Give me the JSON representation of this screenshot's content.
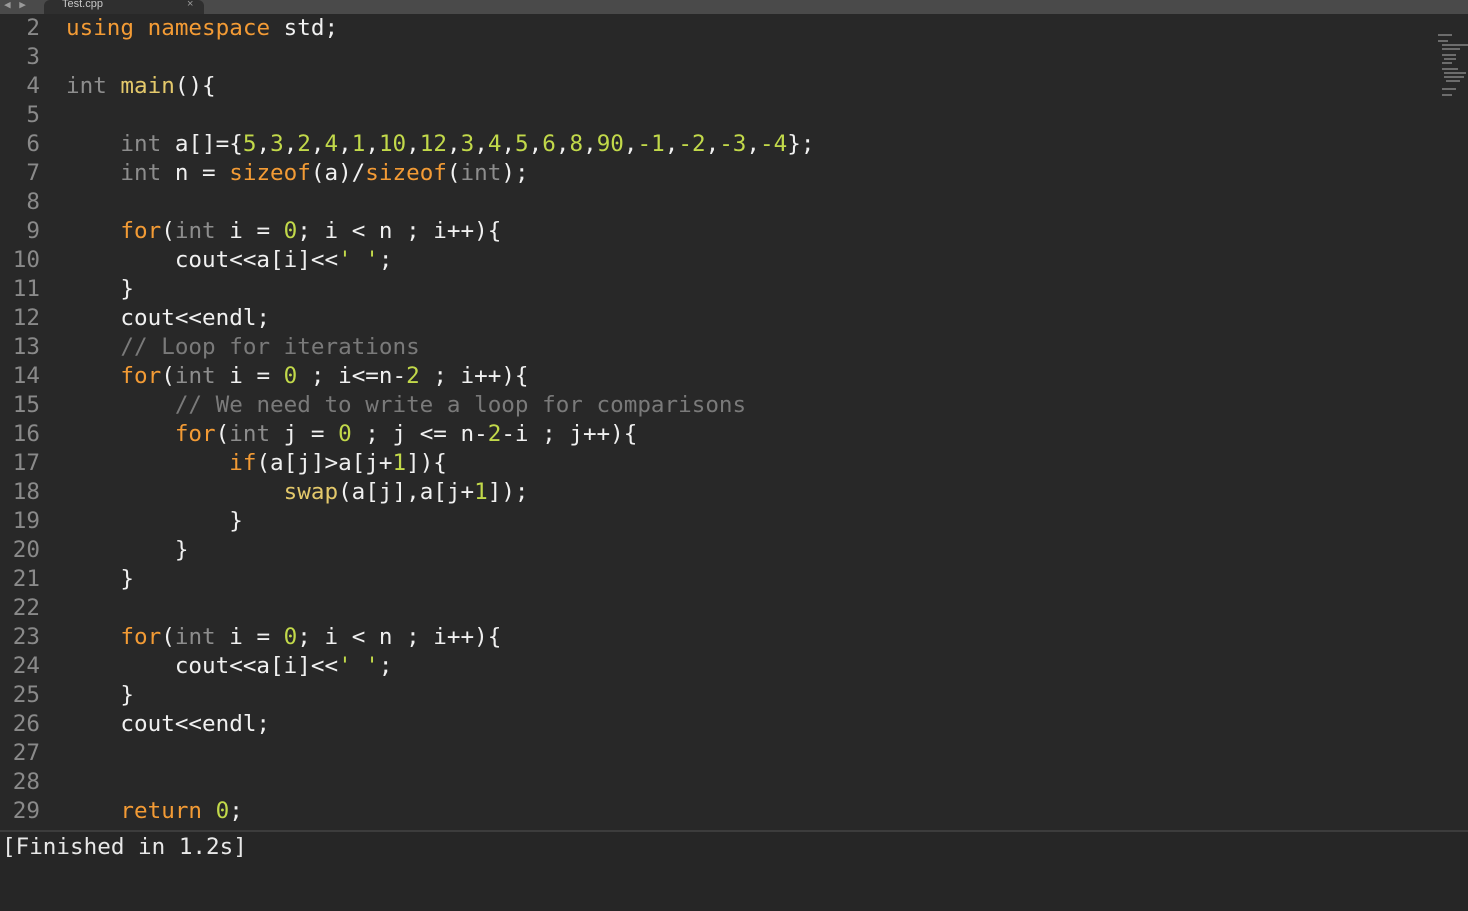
{
  "tab": {
    "title": "Test.cpp",
    "close": "×",
    "nav": "◀ ▶"
  },
  "lines": [
    {
      "n": "2",
      "tokens": [
        [
          "kw",
          "using"
        ],
        [
          "p",
          " "
        ],
        [
          "kw",
          "namespace"
        ],
        [
          "p",
          " std;"
        ]
      ]
    },
    {
      "n": "3",
      "tokens": []
    },
    {
      "n": "4",
      "tokens": [
        [
          "ty",
          "int"
        ],
        [
          "p",
          " "
        ],
        [
          "fn",
          "main"
        ],
        [
          "p",
          "(){"
        ]
      ]
    },
    {
      "n": "5",
      "tokens": []
    },
    {
      "n": "6",
      "tokens": [
        [
          "p",
          "    "
        ],
        [
          "ty",
          "int"
        ],
        [
          "p",
          " a[]={"
        ],
        [
          "num",
          "5"
        ],
        [
          "p",
          ","
        ],
        [
          "num",
          "3"
        ],
        [
          "p",
          ","
        ],
        [
          "num",
          "2"
        ],
        [
          "p",
          ","
        ],
        [
          "num",
          "4"
        ],
        [
          "p",
          ","
        ],
        [
          "num",
          "1"
        ],
        [
          "p",
          ","
        ],
        [
          "num",
          "10"
        ],
        [
          "p",
          ","
        ],
        [
          "num",
          "12"
        ],
        [
          "p",
          ","
        ],
        [
          "num",
          "3"
        ],
        [
          "p",
          ","
        ],
        [
          "num",
          "4"
        ],
        [
          "p",
          ","
        ],
        [
          "num",
          "5"
        ],
        [
          "p",
          ","
        ],
        [
          "num",
          "6"
        ],
        [
          "p",
          ","
        ],
        [
          "num",
          "8"
        ],
        [
          "p",
          ","
        ],
        [
          "num",
          "90"
        ],
        [
          "p",
          ","
        ],
        [
          "num",
          "-1"
        ],
        [
          "p",
          ","
        ],
        [
          "num",
          "-2"
        ],
        [
          "p",
          ","
        ],
        [
          "num",
          "-3"
        ],
        [
          "p",
          ","
        ],
        [
          "num",
          "-4"
        ],
        [
          "p",
          "};"
        ]
      ]
    },
    {
      "n": "7",
      "tokens": [
        [
          "p",
          "    "
        ],
        [
          "ty",
          "int"
        ],
        [
          "p",
          " n = "
        ],
        [
          "bi",
          "sizeof"
        ],
        [
          "p",
          "(a)/"
        ],
        [
          "bi",
          "sizeof"
        ],
        [
          "p",
          "("
        ],
        [
          "ty",
          "int"
        ],
        [
          "p",
          ");"
        ]
      ]
    },
    {
      "n": "8",
      "tokens": []
    },
    {
      "n": "9",
      "tokens": [
        [
          "p",
          "    "
        ],
        [
          "kw",
          "for"
        ],
        [
          "p",
          "("
        ],
        [
          "ty",
          "int"
        ],
        [
          "p",
          " i = "
        ],
        [
          "num",
          "0"
        ],
        [
          "p",
          "; i < n ; i++){"
        ]
      ]
    },
    {
      "n": "10",
      "tokens": [
        [
          "p",
          "        cout<<a[i]<<"
        ],
        [
          "str",
          "' '"
        ],
        [
          "p",
          ";"
        ]
      ]
    },
    {
      "n": "11",
      "tokens": [
        [
          "p",
          "    }"
        ]
      ]
    },
    {
      "n": "12",
      "tokens": [
        [
          "p",
          "    cout<<endl;"
        ]
      ]
    },
    {
      "n": "13",
      "tokens": [
        [
          "p",
          "    "
        ],
        [
          "cm",
          "// Loop for iterations"
        ]
      ]
    },
    {
      "n": "14",
      "tokens": [
        [
          "p",
          "    "
        ],
        [
          "kw",
          "for"
        ],
        [
          "p",
          "("
        ],
        [
          "ty",
          "int"
        ],
        [
          "p",
          " i = "
        ],
        [
          "num",
          "0"
        ],
        [
          "p",
          " ; i<=n-"
        ],
        [
          "num",
          "2"
        ],
        [
          "p",
          " ; i++){"
        ]
      ]
    },
    {
      "n": "15",
      "tokens": [
        [
          "p",
          "        "
        ],
        [
          "cm",
          "// We need to write a loop for comparisons"
        ]
      ]
    },
    {
      "n": "16",
      "tokens": [
        [
          "p",
          "        "
        ],
        [
          "kw",
          "for"
        ],
        [
          "p",
          "("
        ],
        [
          "ty",
          "int"
        ],
        [
          "p",
          " j = "
        ],
        [
          "num",
          "0"
        ],
        [
          "p",
          " ; j <= n-"
        ],
        [
          "num",
          "2"
        ],
        [
          "p",
          "-i ; j++){"
        ]
      ]
    },
    {
      "n": "17",
      "tokens": [
        [
          "p",
          "            "
        ],
        [
          "kw",
          "if"
        ],
        [
          "p",
          "(a[j]>a[j+"
        ],
        [
          "num",
          "1"
        ],
        [
          "p",
          "]){"
        ]
      ]
    },
    {
      "n": "18",
      "tokens": [
        [
          "p",
          "                "
        ],
        [
          "fn",
          "swap"
        ],
        [
          "p",
          "(a[j],a[j+"
        ],
        [
          "num",
          "1"
        ],
        [
          "p",
          "]);"
        ]
      ]
    },
    {
      "n": "19",
      "tokens": [
        [
          "p",
          "            }"
        ]
      ]
    },
    {
      "n": "20",
      "tokens": [
        [
          "p",
          "        }"
        ]
      ]
    },
    {
      "n": "21",
      "tokens": [
        [
          "p",
          "    }"
        ]
      ]
    },
    {
      "n": "22",
      "tokens": []
    },
    {
      "n": "23",
      "tokens": [
        [
          "p",
          "    "
        ],
        [
          "kw",
          "for"
        ],
        [
          "p",
          "("
        ],
        [
          "ty",
          "int"
        ],
        [
          "p",
          " i = "
        ],
        [
          "num",
          "0"
        ],
        [
          "p",
          "; i < n ; i++){"
        ]
      ]
    },
    {
      "n": "24",
      "tokens": [
        [
          "p",
          "        cout<<a[i]<<"
        ],
        [
          "str",
          "' '"
        ],
        [
          "p",
          ";"
        ]
      ]
    },
    {
      "n": "25",
      "tokens": [
        [
          "p",
          "    }"
        ]
      ]
    },
    {
      "n": "26",
      "tokens": [
        [
          "p",
          "    cout<<endl;"
        ]
      ]
    },
    {
      "n": "27",
      "tokens": []
    },
    {
      "n": "28",
      "tokens": []
    },
    {
      "n": "29",
      "tokens": [
        [
          "p",
          "    "
        ],
        [
          "kw",
          "return"
        ],
        [
          "p",
          " "
        ],
        [
          "num",
          "0"
        ],
        [
          "p",
          ";"
        ]
      ]
    }
  ],
  "output": {
    "text": "[Finished in 1.2s]"
  }
}
